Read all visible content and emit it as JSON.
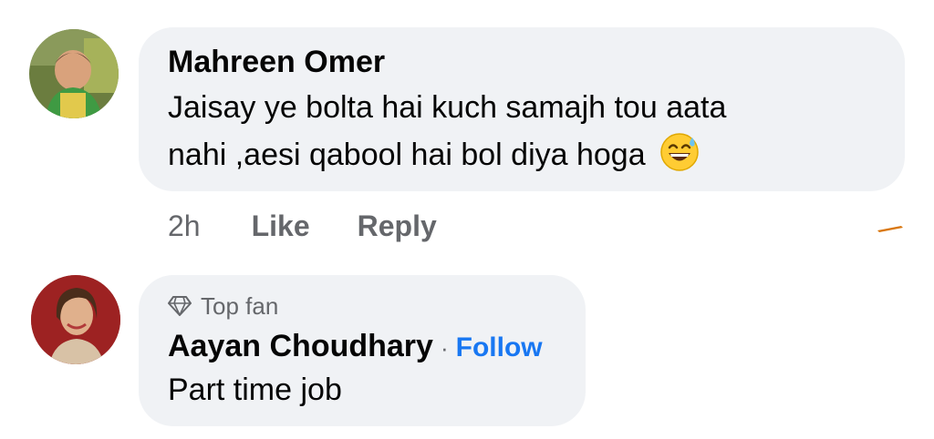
{
  "comments": [
    {
      "author": "Mahreen Omer",
      "text_line1": "Jaisay ye bolta hai kuch samajh tou aata",
      "text_line2": "nahi ,aesi qabool hai bol diya hoga",
      "emoji": "sweat-smile-emoji",
      "time": "2h",
      "like_label": "Like",
      "reply_label": "Reply"
    },
    {
      "badge_icon": "diamond-icon",
      "badge": "Top fan",
      "author": "Aayan Choudhary",
      "separator": "·",
      "follow_label": "Follow",
      "text": "Part time job"
    }
  ],
  "colors": {
    "bubble": "#f0f2f5",
    "secondary_text": "#65676b",
    "link_blue": "#1877f2",
    "primary_text": "#050505"
  }
}
